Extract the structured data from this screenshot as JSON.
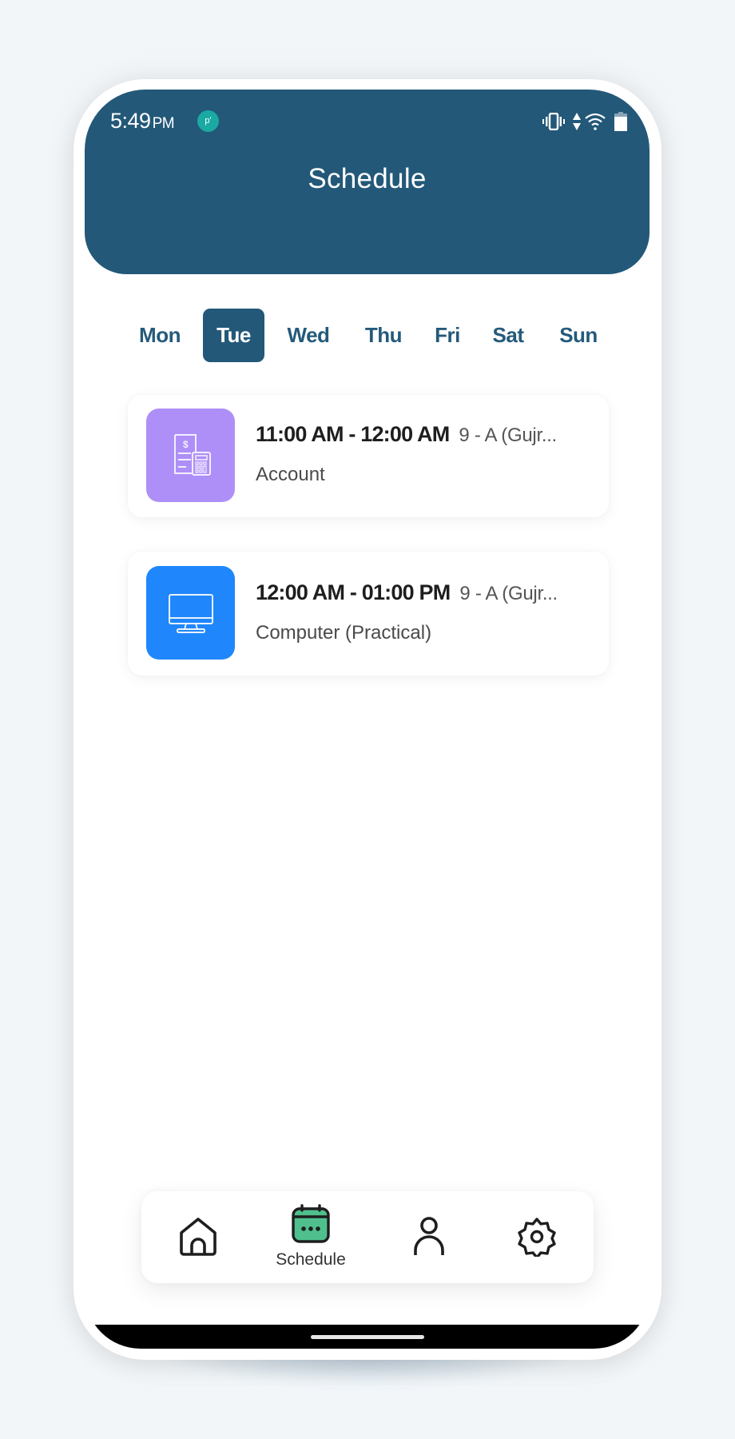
{
  "status_bar": {
    "time": "5:49",
    "ampm": "PM",
    "notification_badge": "p'",
    "icons": [
      "vibrate-icon",
      "data-arrows-icon",
      "wifi-icon",
      "battery-icon"
    ]
  },
  "header": {
    "title": "Schedule"
  },
  "day_tabs": {
    "selected": "Tue",
    "items": [
      {
        "label": "Mon"
      },
      {
        "label": "Tue"
      },
      {
        "label": "Wed"
      },
      {
        "label": "Thu"
      },
      {
        "label": "Fri"
      },
      {
        "label": "Sat"
      },
      {
        "label": "Sun"
      }
    ]
  },
  "schedule": [
    {
      "time": "11:00 AM - 12:00 AM",
      "class": "9 - A (Gujr...",
      "subject": "Account",
      "icon": "accounting-calculator-icon",
      "icon_bg": "#ae8ff7"
    },
    {
      "time": "12:00 AM - 01:00 PM",
      "class": "9 - A (Gujr...",
      "subject": "Computer (Practical)",
      "icon": "computer-monitor-icon",
      "icon_bg": "#1f87fb"
    }
  ],
  "bottom_nav": {
    "active": "Schedule",
    "items": [
      {
        "icon": "home-icon",
        "label": ""
      },
      {
        "icon": "calendar-icon",
        "label": "Schedule"
      },
      {
        "icon": "profile-icon",
        "label": ""
      },
      {
        "icon": "settings-gear-icon",
        "label": ""
      }
    ]
  },
  "colors": {
    "primary": "#235878",
    "background": "#f2f6f9",
    "active_nav_icon": "#4fc08d",
    "badge": "#1aa9a3"
  }
}
